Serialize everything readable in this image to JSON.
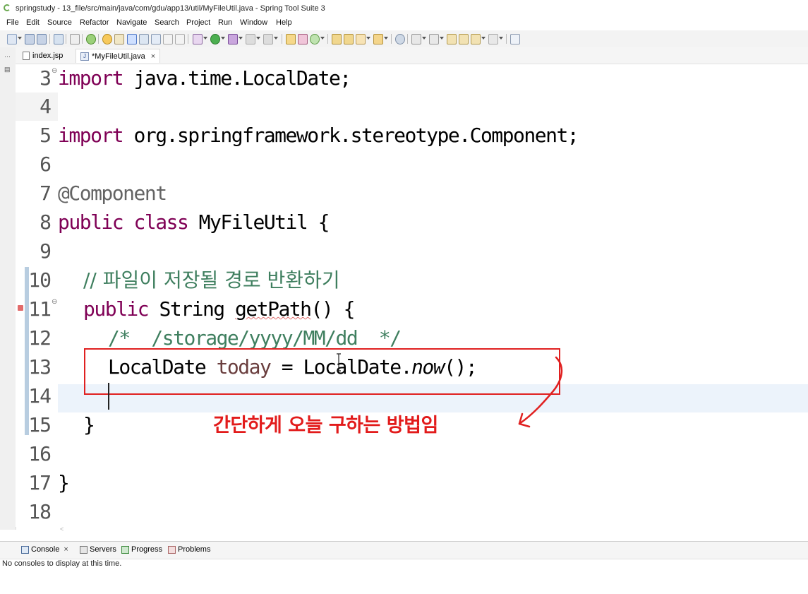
{
  "window": {
    "title": "springstudy - 13_file/src/main/java/com/gdu/app13/util/MyFileUtil.java - Spring Tool Suite 3"
  },
  "menu": [
    "File",
    "Edit",
    "Source",
    "Refactor",
    "Navigate",
    "Search",
    "Project",
    "Run",
    "Window",
    "Help"
  ],
  "tabs": [
    {
      "label": "index.jsp",
      "icon": "jsp-file-icon",
      "active": false
    },
    {
      "label": "*MyFileUtil.java",
      "icon": "java-file-icon",
      "active": true
    }
  ],
  "close_glyph": "×",
  "editor": {
    "lines": [
      {
        "num": "3",
        "code": "import java.time.LocalDate;"
      },
      {
        "num": "4",
        "code": ""
      },
      {
        "num": "5",
        "code": "import org.springframework.stereotype.Component;"
      },
      {
        "num": "6",
        "code": ""
      },
      {
        "num": "7",
        "code": "@Component"
      },
      {
        "num": "8",
        "code": "public class MyFileUtil {"
      },
      {
        "num": "9",
        "code": ""
      },
      {
        "num": "10",
        "code": "  // 파일이 저장될 경로 반환하기"
      },
      {
        "num": "11",
        "code": "  public String getPath() {"
      },
      {
        "num": "12",
        "code": "    /*  /storage/yyyy/MM/dd  */"
      },
      {
        "num": "13",
        "code": "    LocalDate today = LocalDate.now();"
      },
      {
        "num": "14",
        "code": ""
      },
      {
        "num": "15",
        "code": "  }"
      },
      {
        "num": "16",
        "code": ""
      },
      {
        "num": "17",
        "code": "}"
      },
      {
        "num": "18",
        "code": ""
      }
    ],
    "tokens": {
      "kw_import": "import",
      "import1": " java.time.LocalDate;",
      "import2": " org.springframework.stereotype.Component;",
      "annotation": "@Component",
      "kw_public": "public",
      "kw_class": "class",
      "class_rest": " MyFileUtil {",
      "comment_line": "// 파일이 저장될 경로 반환하기",
      "method_type": " String ",
      "method_name": "getPath",
      "method_rest": "() {",
      "block_comment": "/*  /storage/yyyy/MM/dd  */",
      "decl_type": "LocalDate ",
      "decl_var": "today",
      "decl_mid": " = LocalDate.",
      "decl_call": "now",
      "decl_end": "();",
      "close_method": "}",
      "close_class": "}"
    }
  },
  "annotation_note": "간단하게 오늘 구하는 방법임",
  "bottom_panel": {
    "tabs": [
      {
        "label": "Console",
        "icon": "console-icon",
        "closable": true
      },
      {
        "label": "Servers",
        "icon": "servers-icon"
      },
      {
        "label": "Progress",
        "icon": "progress-icon"
      },
      {
        "label": "Problems",
        "icon": "problems-icon"
      }
    ],
    "message": "No consoles to display at this time."
  },
  "colors": {
    "keyword": "#7f0055",
    "comment": "#3f7f5f",
    "annotation": "#646464",
    "highlight": "#e21b1b"
  }
}
